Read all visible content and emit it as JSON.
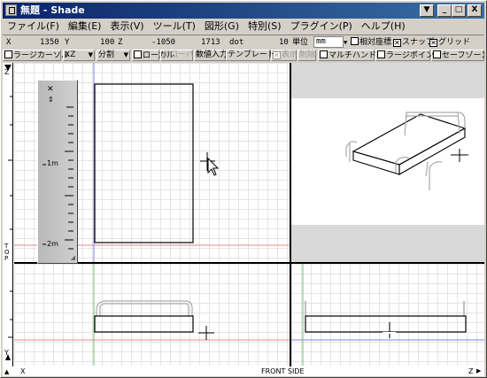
{
  "window": {
    "title": "無題 - Shade",
    "minimize": "_",
    "maximize": "□",
    "close": "X",
    "dropdown": "▼"
  },
  "menu": [
    "ファイル(F)",
    "編集(E)",
    "表示(V)",
    "ツール(T)",
    "図形(G)",
    "特別(S)",
    "プラグイン(P)",
    "ヘルプ(H)"
  ],
  "coords": {
    "x_label": "X",
    "x": "1350",
    "y_label": "Y",
    "y": "100",
    "z_label": "Z",
    "z": "-1050",
    "size": "1713",
    "size_unit": "dot",
    "scale": "10",
    "unit_label": "単位",
    "unit": "mm",
    "relative": "相対座標",
    "snap": "スナップ",
    "grid": "グリッド"
  },
  "toolbar": {
    "large_cursor": "ラージカーソル",
    "plane": "XZ",
    "divide": "分割",
    "local": "ローカル",
    "global": "グローバル",
    "numeric": "数値入力",
    "template": "テンプレート",
    "show": "表示",
    "delete": "削除",
    "multi_handle": "マルチハンドル",
    "large_point": "ラージポイント",
    "safe_zone": "セーフゾーン"
  },
  "palette": {
    "m1": "1m",
    "m2": "2m",
    "close": "✕"
  },
  "rulers": {
    "z": "Z",
    "top": "TOP",
    "y": "Y"
  },
  "status": {
    "x": "X",
    "label": "FRONT SIDE",
    "z": "Z"
  },
  "colors": {
    "title_start": "#0a246a",
    "title_end": "#3a6ea5",
    "x_axis": "#e08a8a",
    "z_axis": "#8080e0",
    "y_axis": "#70c070"
  }
}
